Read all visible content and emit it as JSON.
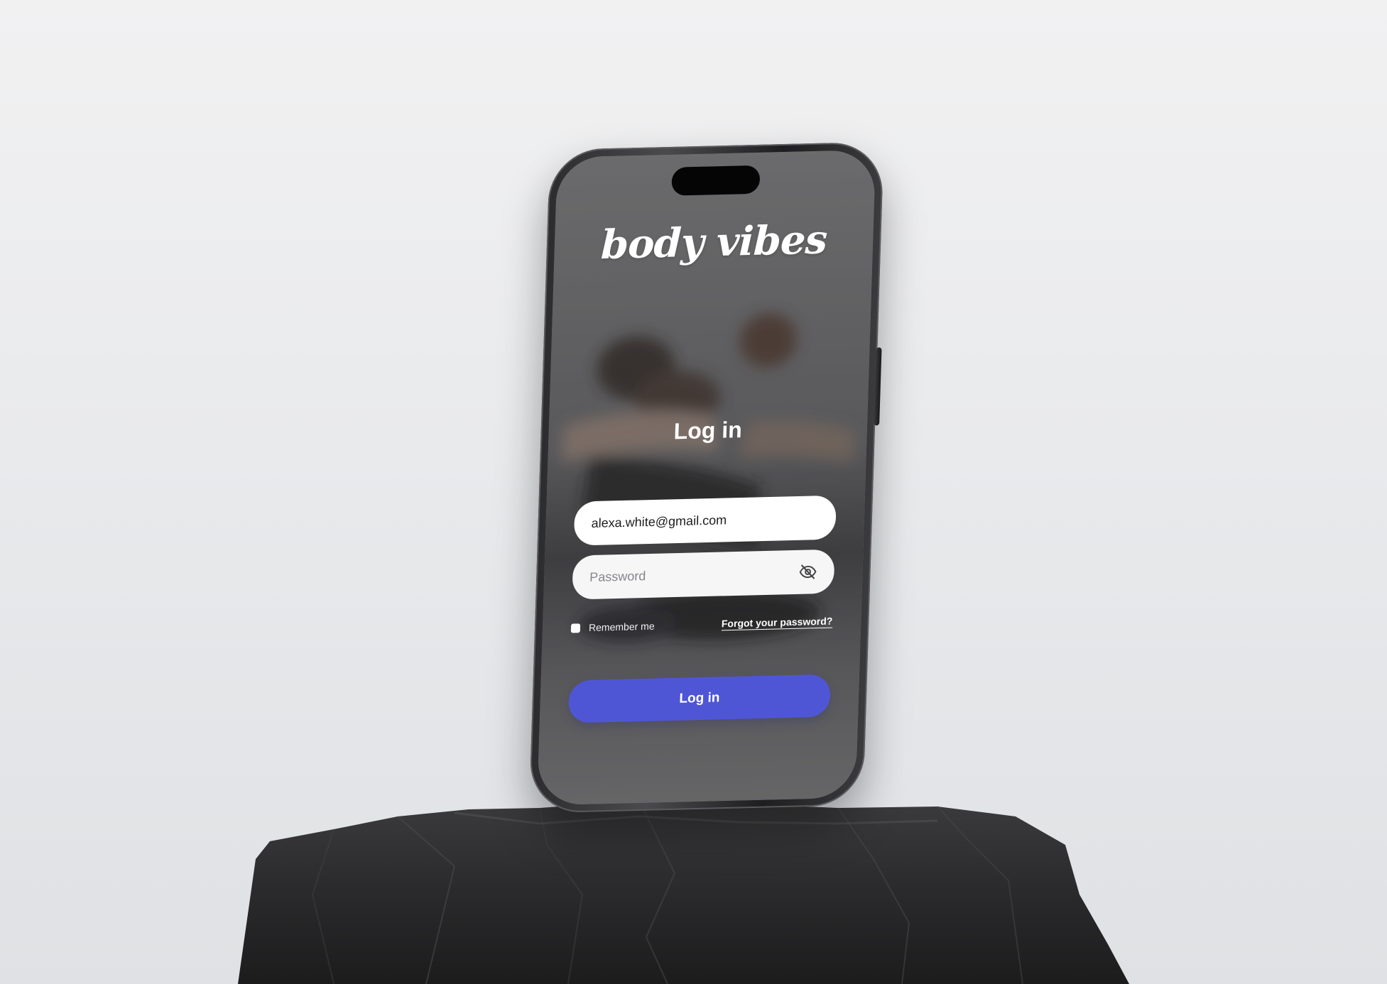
{
  "app": {
    "logo_text": "body vibes"
  },
  "login": {
    "title": "Log in",
    "email_value": "alexa.white@gmail.com",
    "password_placeholder": "Password",
    "remember_label": "Remember me",
    "remember_checked": false,
    "forgot_label": "Forgot your password?",
    "submit_label": "Log in"
  },
  "icons": {
    "password_toggle": "eye-off-icon"
  },
  "colors": {
    "accent": "#4f56d6",
    "background": "#ececee",
    "screen_overlay": "#6e6e6f"
  }
}
